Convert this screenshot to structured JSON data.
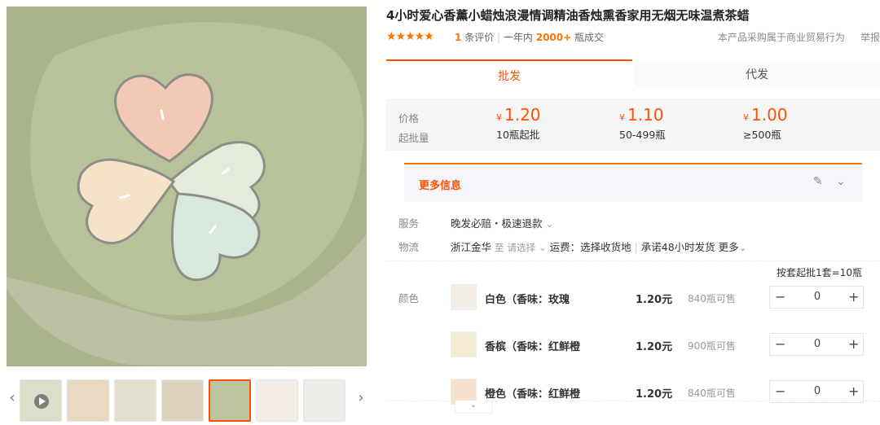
{
  "product": {
    "title": "4小时爱心香薰小蜡烛浪漫情调精油香烛熏香家用无烟无味温煮茶蜡",
    "stars": "★★★★★",
    "review_count": "1",
    "review_label": "条评价",
    "sold_prefix": "一年内",
    "sold_count": "2000+",
    "sold_suffix": "瓶成交",
    "purchase_note": "本产品采购属于商业贸易行为",
    "report": "举报"
  },
  "tabs": [
    {
      "label": "批发"
    },
    {
      "label": "代发"
    }
  ],
  "pricing": {
    "price_label": "价格",
    "moq_label": "起批量",
    "currency": "¥",
    "tiers": [
      {
        "price": "1.20",
        "qty": "10瓶起批"
      },
      {
        "price": "1.10",
        "qty": "50-499瓶"
      },
      {
        "price": "1.00",
        "qty": "≥500瓶"
      }
    ]
  },
  "more_info": {
    "label": "更多信息"
  },
  "service": {
    "label": "服务",
    "value": "晚发必赔・极速退款"
  },
  "logistics": {
    "label": "物流",
    "origin": "浙江金华",
    "to": "至",
    "select": "请选择",
    "freight": "运费：选择收货地",
    "promise": "承诺48小时发货",
    "more": "更多"
  },
  "set_note": "按套起批1套=10瓶",
  "color_label": "颜色",
  "skus": [
    {
      "name": "白色（香味：玫瑰",
      "price": "1.20元",
      "stock": "840瓶可售",
      "qty": "0"
    },
    {
      "name": "香槟（香味：红鲜橙",
      "price": "1.20元",
      "stock": "900瓶可售",
      "qty": "0"
    },
    {
      "name": "橙色（香味：红鲜橙",
      "price": "1.20元",
      "stock": "840瓶可售",
      "qty": "0"
    }
  ],
  "icons": {
    "minus": "−",
    "plus": "+",
    "prev": "‹",
    "next": "›",
    "chevron": "⌄"
  },
  "colors": {
    "accent": "#ff5000",
    "star": "#ff7300"
  }
}
